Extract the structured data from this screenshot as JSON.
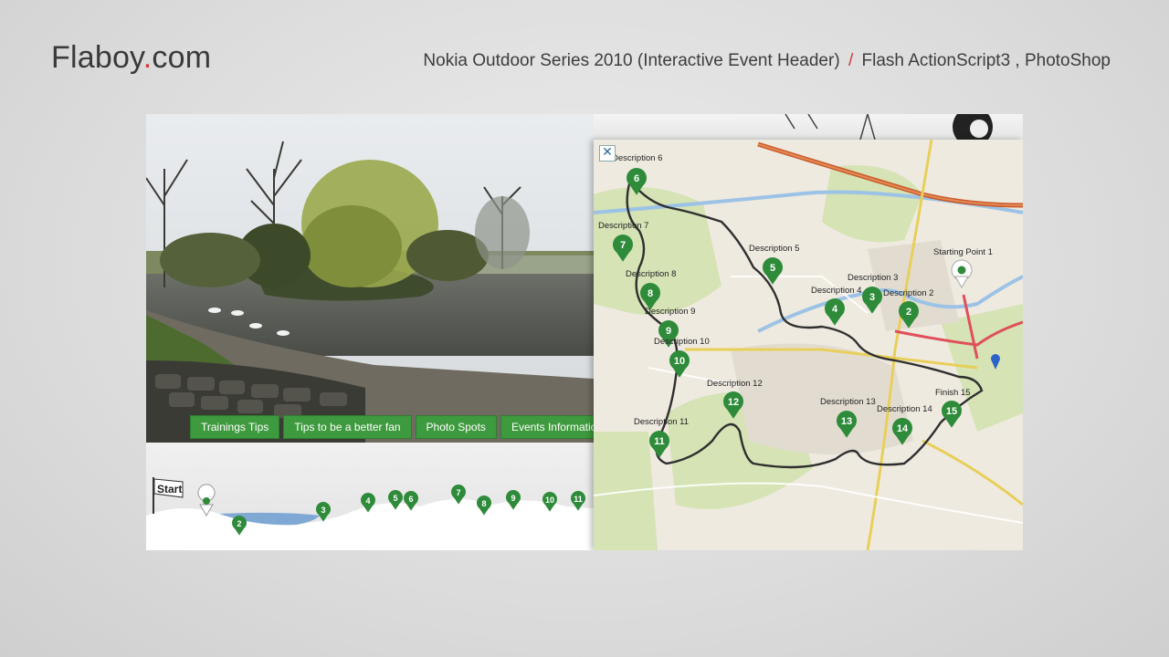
{
  "header": {
    "logo_main": "Flaboy",
    "logo_dot": ".",
    "logo_tld": "com",
    "title": "Nokia Outdoor Series 2010 (Interactive Event Header)",
    "slash": "/",
    "tech": "Flash ActionScript3 , PhotoShop"
  },
  "nav": {
    "items": [
      {
        "label": "Trainings Tips"
      },
      {
        "label": "Tips to be a better fan"
      },
      {
        "label": "Photo Spots"
      },
      {
        "label": "Events Information"
      }
    ]
  },
  "elevation": {
    "start_label": "Start",
    "markers": [
      "2",
      "3",
      "4",
      "5",
      "6",
      "7",
      "8",
      "9",
      "10",
      "11"
    ]
  },
  "map": {
    "close_label": "✕",
    "pins": [
      {
        "num": "2",
        "label": "Description 2"
      },
      {
        "num": "3",
        "label": "Description 3"
      },
      {
        "num": "4",
        "label": "Description 4"
      },
      {
        "num": "5",
        "label": "Description 5"
      },
      {
        "num": "6",
        "label": "Description 6"
      },
      {
        "num": "7",
        "label": "Description 7"
      },
      {
        "num": "8",
        "label": "Description 8"
      },
      {
        "num": "9",
        "label": "Description 9"
      },
      {
        "num": "10",
        "label": "Description 10"
      },
      {
        "num": "11",
        "label": "Description 11"
      },
      {
        "num": "12",
        "label": "Description 12"
      },
      {
        "num": "13",
        "label": "Description 13"
      },
      {
        "num": "14",
        "label": "Description 14"
      },
      {
        "num": "15",
        "label": "Finish 15"
      }
    ],
    "start_label": "Starting Point 1",
    "colors": {
      "pin": "#2e8b3a",
      "route": "#333333",
      "motorway": "#d9602f",
      "water": "#9cc3e6"
    }
  }
}
